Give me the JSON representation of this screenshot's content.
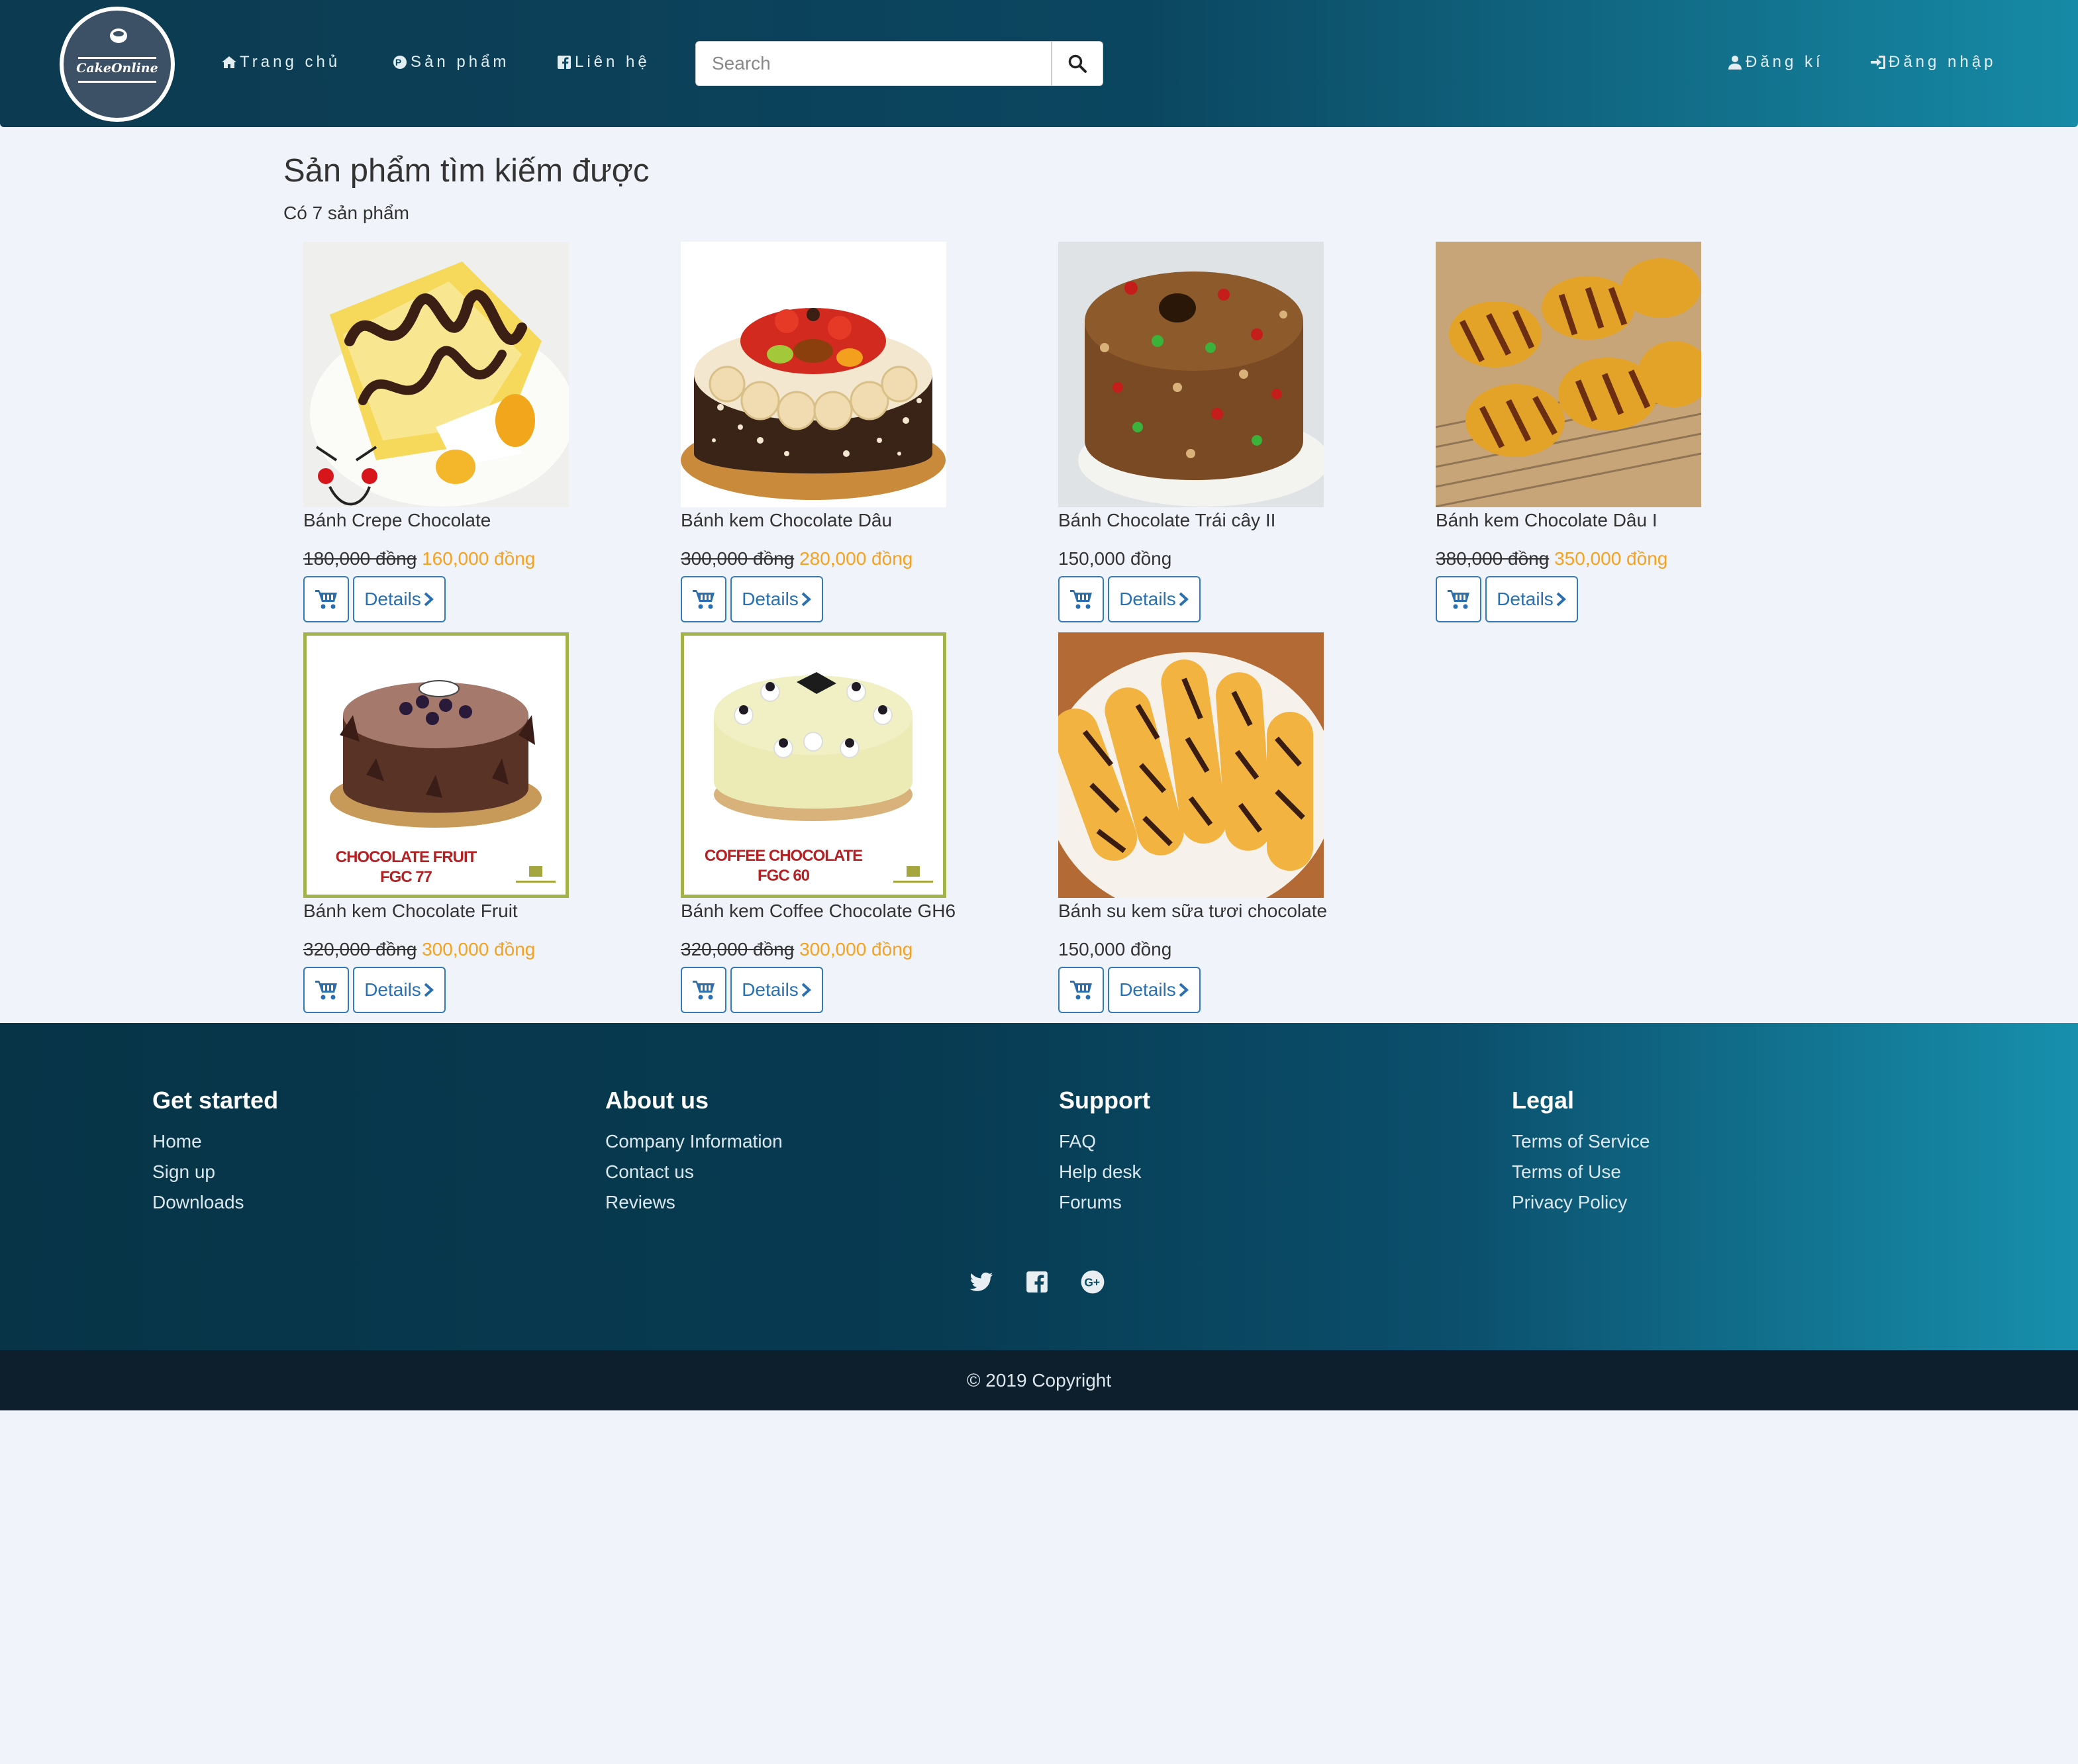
{
  "brand": {
    "logo_text": "CakeOnline"
  },
  "nav": {
    "home": "Trang chủ",
    "products": "Sản phẩm",
    "contact": "Liên hệ",
    "register": "Đăng kí",
    "login": "Đăng nhập",
    "search_placeholder": "Search"
  },
  "main": {
    "title": "Sản phẩm tìm kiếm được",
    "count": "Có 7 sản phẩm",
    "details_label": "Details",
    "products": [
      {
        "name": "Bánh Crepe Chocolate",
        "old_price": "180,000 đồng",
        "new_price": "160,000 đồng",
        "price": ""
      },
      {
        "name": "Bánh kem Chocolate Dâu",
        "old_price": "300,000 đồng",
        "new_price": "280,000 đồng",
        "price": ""
      },
      {
        "name": "Bánh Chocolate Trái cây II",
        "old_price": "",
        "new_price": "",
        "price": "150,000 đồng"
      },
      {
        "name": "Bánh kem Chocolate Dâu I",
        "old_price": "380,000 đồng",
        "new_price": "350,000 đồng",
        "price": ""
      },
      {
        "name": "Bánh kem Chocolate Fruit",
        "old_price": "320,000 đồng",
        "new_price": "300,000 đồng",
        "price": "",
        "image_caption": [
          "CHOCOLATE FRUIT",
          "FGC 77"
        ]
      },
      {
        "name": "Bánh kem Coffee Chocolate GH6",
        "old_price": "320,000 đồng",
        "new_price": "300,000 đồng",
        "price": "",
        "image_caption": [
          "COFFEE CHOCOLATE",
          "FGC 60"
        ]
      },
      {
        "name": "Bánh su kem sữa tươi chocolate",
        "old_price": "",
        "new_price": "",
        "price": "150,000 đồng"
      }
    ]
  },
  "footer": {
    "columns": [
      {
        "title": "Get started",
        "links": [
          "Home",
          "Sign up",
          "Downloads"
        ]
      },
      {
        "title": "About us",
        "links": [
          "Company Information",
          "Contact us",
          "Reviews"
        ]
      },
      {
        "title": "Support",
        "links": [
          "FAQ",
          "Help desk",
          "Forums"
        ]
      },
      {
        "title": "Legal",
        "links": [
          "Terms of Service",
          "Terms of Use",
          "Privacy Policy"
        ]
      }
    ],
    "social_icons": [
      "twitter-icon",
      "facebook-icon",
      "google-plus-icon"
    ],
    "copyright": "© 2019 Copyright"
  },
  "colors": {
    "accent": "#337ab7",
    "sale_price": "#f5a21e",
    "nav_dark": "#0c3a50",
    "nav_light": "#168aa6"
  }
}
